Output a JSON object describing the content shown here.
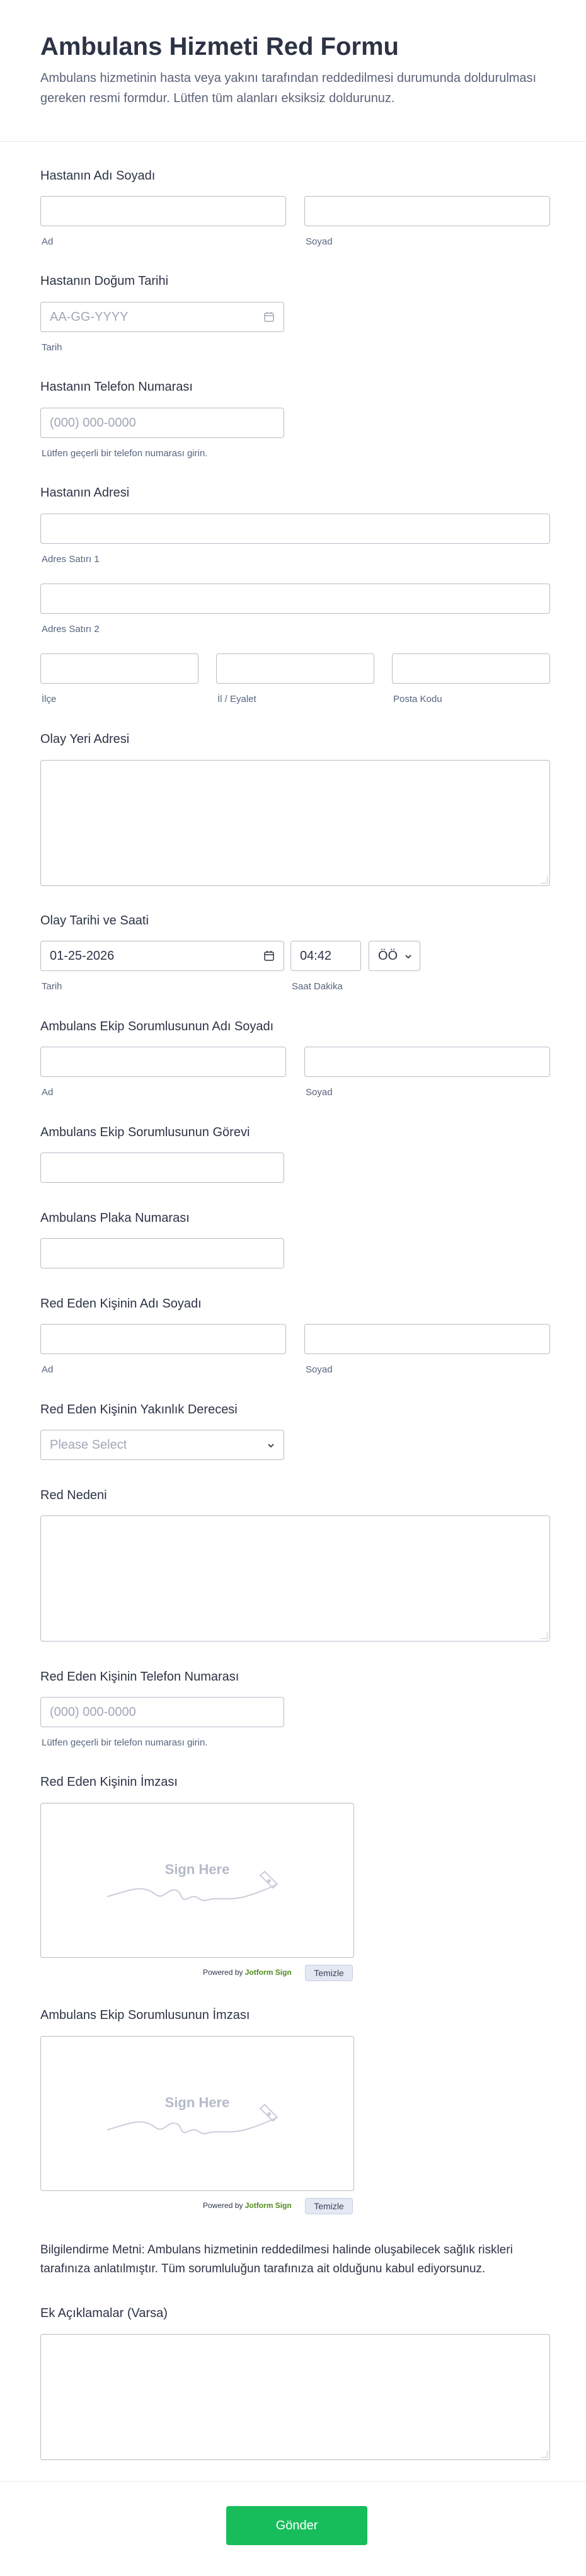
{
  "header": {
    "title": "Ambulans Hizmeti Red Formu",
    "subtitle": "Ambulans hizmetinin hasta veya yakını tarafından reddedilmesi durumunda doldurulması gereken resmi formdur. Lütfen tüm alanları eksiksiz doldurunuz."
  },
  "patient_name": {
    "label": "Hastanın Adı Soyadı",
    "first_sub": "Ad",
    "last_sub": "Soyad"
  },
  "birth_date": {
    "label": "Hastanın Doğum Tarihi",
    "placeholder": "AA-GG-YYYY",
    "sub": "Tarih"
  },
  "patient_phone": {
    "label": "Hastanın Telefon Numarası",
    "placeholder": "(000) 000-0000",
    "sub": "Lütfen geçerli bir telefon numarası girin."
  },
  "address": {
    "label": "Hastanın Adresi",
    "line1_sub": "Adres Satırı 1",
    "line2_sub": "Adres Satırı 2",
    "district_sub": "İlçe",
    "province_sub": "İl / Eyalet",
    "postal_sub": "Posta Kodu"
  },
  "incident_address": {
    "label": "Olay Yeri Adresi"
  },
  "incident_datetime": {
    "label": "Olay Tarihi ve Saati",
    "date_value": "01-25-2026",
    "time_value": "04:42",
    "ampm_value": "ÖÖ",
    "date_sub": "Tarih",
    "time_sub": "Saat Dakika"
  },
  "crew_lead_name": {
    "label": "Ambulans Ekip Sorumlusunun Adı Soyadı",
    "first_sub": "Ad",
    "last_sub": "Soyad"
  },
  "crew_lead_role": {
    "label": "Ambulans Ekip Sorumlusunun Görevi"
  },
  "plate": {
    "label": "Ambulans Plaka Numarası"
  },
  "refuser_name": {
    "label": "Red Eden Kişinin Adı Soyadı",
    "first_sub": "Ad",
    "last_sub": "Soyad"
  },
  "relation": {
    "label": "Red Eden Kişinin Yakınlık Derecesi",
    "placeholder": "Please Select"
  },
  "reason": {
    "label": "Red Nedeni"
  },
  "refuser_phone": {
    "label": "Red Eden Kişinin Telefon Numarası",
    "placeholder": "(000) 000-0000",
    "sub": "Lütfen geçerli bir telefon numarası girin."
  },
  "refuser_signature": {
    "label": "Red Eden Kişinin İmzası",
    "sign_here": "Sign Here",
    "powered_prefix": "Powered by ",
    "powered_brand": "Jotform Sign",
    "clear": "Temizle"
  },
  "crew_signature": {
    "label": "Ambulans Ekip Sorumlusunun İmzası",
    "sign_here": "Sign Here",
    "powered_prefix": "Powered by ",
    "powered_brand": "Jotform Sign",
    "clear": "Temizle"
  },
  "info_text": "Bilgilendirme Metni: Ambulans hizmetinin reddedilmesi halinde oluşabilecek sağlık riskleri tarafınıza anlatılmıştır. Tüm sorumluluğun tarafınıza ait olduğunu kabul ediyorsunuz.",
  "notes": {
    "label": "Ek Açıklamalar (Varsa)"
  },
  "submit_label": "Gönder"
}
